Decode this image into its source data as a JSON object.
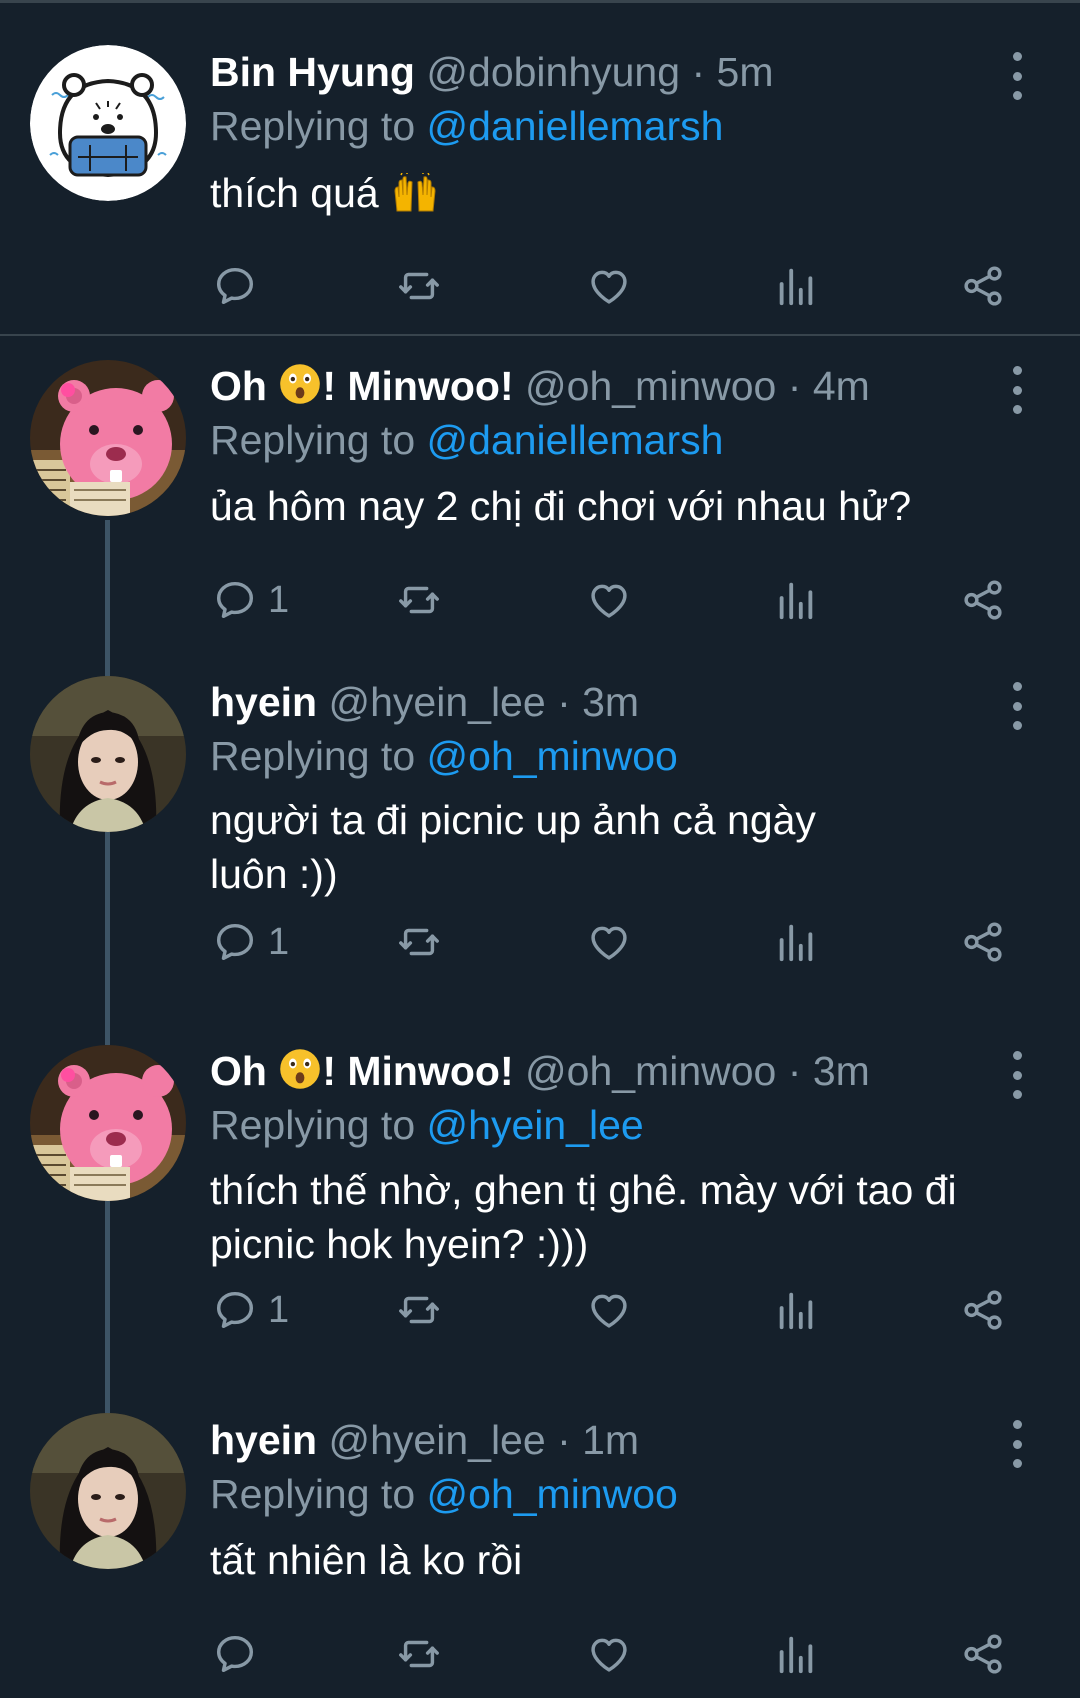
{
  "colors": {
    "background": "#15202b",
    "secondary_text": "#8899a6",
    "mention": "#1d9bf0",
    "divider": "#38444d"
  },
  "tweets": [
    {
      "name": "Bin Hyung",
      "handle": "@dobinhyung",
      "time": "5m",
      "replying_label": "Replying to",
      "replying_to": "@daniellemarsh",
      "text": "thích quá",
      "text_emoji": "raising-hands-emoji",
      "avatar": "white-bear-avatar",
      "reply_count": ""
    },
    {
      "name_pre": "Oh",
      "name_emoji": "astonished-face-emoji",
      "name_post": "! Minwoo!",
      "handle": "@oh_minwoo",
      "time": "4m",
      "replying_label": "Replying to",
      "replying_to": "@daniellemarsh",
      "text": "ủa hôm nay 2 chị đi chơi với nhau hử?",
      "avatar": "pink-beaver-avatar",
      "reply_count": "1"
    },
    {
      "name": "hyein",
      "handle": "@hyein_lee",
      "time": "3m",
      "replying_label": "Replying to",
      "replying_to": "@oh_minwoo",
      "text_line1": "người ta đi picnic up ảnh cả ngày",
      "text_line2": "luôn :))",
      "avatar": "girl-photo-avatar",
      "reply_count": "1"
    },
    {
      "name_pre": "Oh",
      "name_emoji": "astonished-face-emoji",
      "name_post": "! Minwoo!",
      "handle": "@oh_minwoo",
      "time": "3m",
      "replying_label": "Replying to",
      "replying_to": "@hyein_lee",
      "text_line1": "thích thế nhờ, ghen tị ghê. mày với tao đi",
      "text_line2": "picnic hok hyein? :)))",
      "avatar": "pink-beaver-avatar",
      "reply_count": "1"
    },
    {
      "name": "hyein",
      "handle": "@hyein_lee",
      "time": "1m",
      "replying_label": "Replying to",
      "replying_to": "@oh_minwoo",
      "text": "tất nhiên là ko rồi",
      "avatar": "girl-photo-avatar",
      "reply_count": ""
    }
  ],
  "separator": "·"
}
